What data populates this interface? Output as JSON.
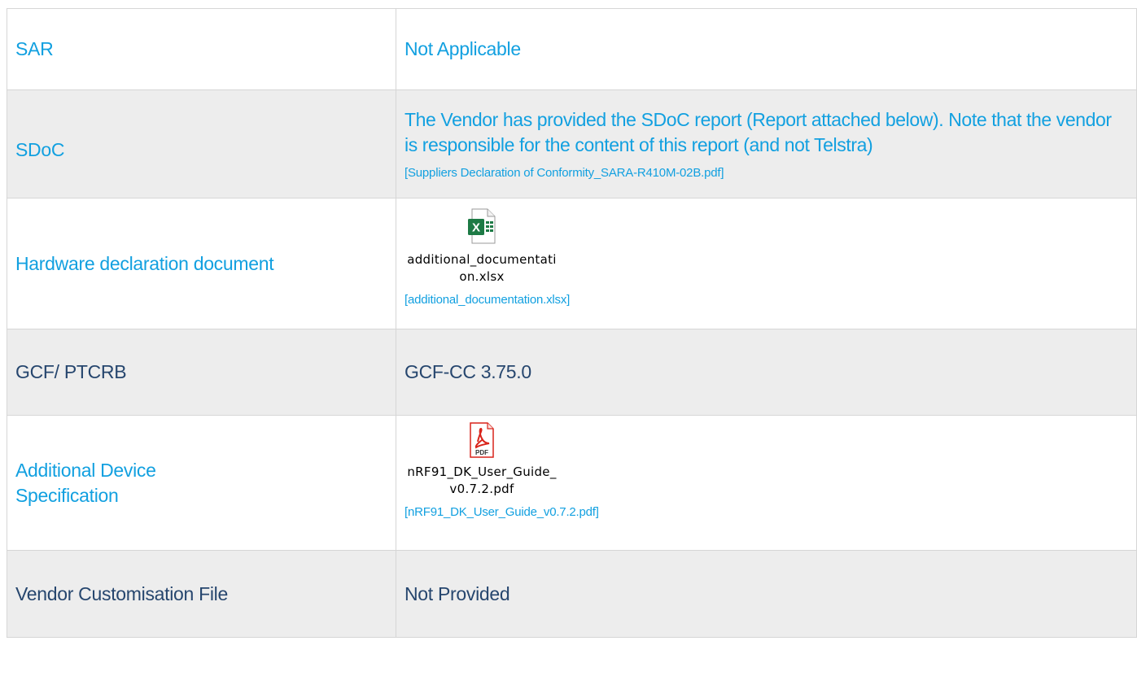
{
  "rows": [
    {
      "label": "SAR",
      "value": "Not Applicable"
    },
    {
      "label": "SDoC",
      "value": "The Vendor has provided the SDoC report (Report attached below). Note that the vendor is responsible for the content of this report (and not Telstra)",
      "link": "[Suppliers Declaration of Conformity_SARA-R410M-02B.pdf]"
    },
    {
      "label": "Hardware declaration document",
      "attachment": {
        "icon": "excel-file-icon",
        "filename": "additional_documentation.xlsx"
      },
      "link": "[additional_documentation.xlsx]"
    },
    {
      "label": "GCF/ PTCRB",
      "value": "GCF-CC 3.75.0"
    },
    {
      "label": "Additional Device Specification",
      "attachment": {
        "icon": "pdf-file-icon",
        "filename": "nRF91_DK_User_Guide_v0.7.2.pdf"
      },
      "link": "[nRF91_DK_User_Guide_v0.7.2.pdf]"
    },
    {
      "label": "Vendor Customisation File",
      "value": "Not Provided"
    }
  ],
  "colors": {
    "accent_blue": "#12a0e0",
    "dark_navy": "#26466e",
    "row_grey": "#ededed",
    "excel_green": "#1d7a45",
    "pdf_red": "#d9241b"
  }
}
